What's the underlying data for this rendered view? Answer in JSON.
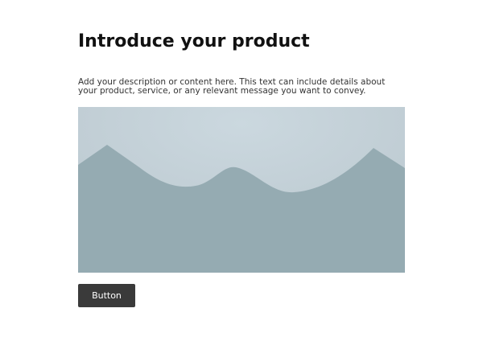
{
  "heading": {
    "title": "Introduce your product"
  },
  "content": {
    "description": "Add your description or content here. This text can include details about your product, service, or any relevant message you want to convey."
  },
  "image": {
    "icon": "landscape-placeholder-icon",
    "sky_color": "#cbd8df",
    "mountain_color": "#95abb2"
  },
  "actions": {
    "button_label": "Button"
  }
}
